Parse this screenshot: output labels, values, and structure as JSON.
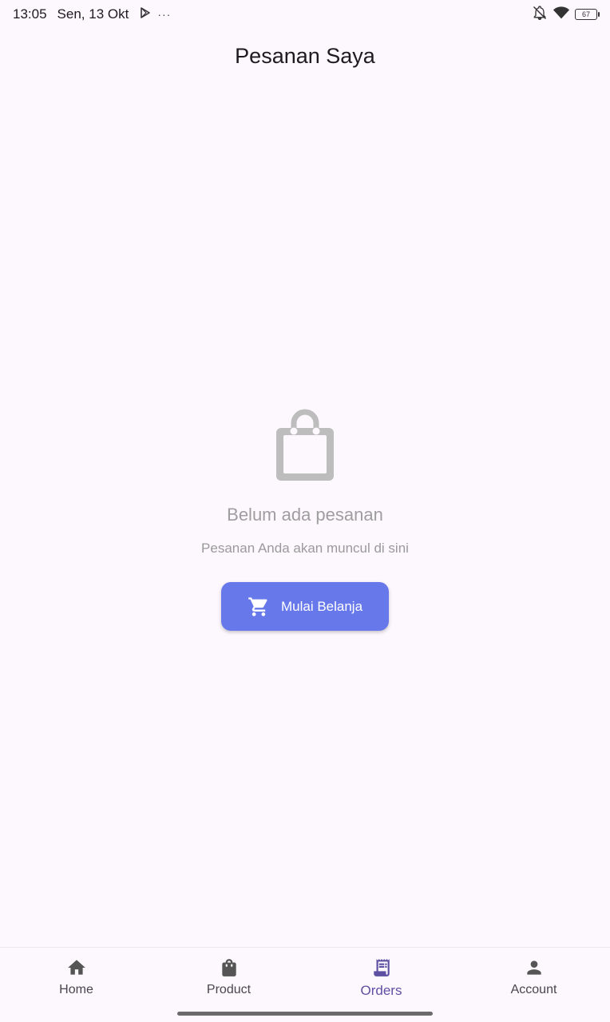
{
  "status_bar": {
    "time": "13:05",
    "date": "Sen, 13 Okt",
    "more": "···",
    "battery": "67"
  },
  "app_bar": {
    "title": "Pesanan Saya"
  },
  "empty_state": {
    "icon": "shopping-bag-icon",
    "title": "Belum ada pesanan",
    "subtitle": "Pesanan Anda akan muncul di sini",
    "button_label": "Mulai Belanja",
    "button_icon": "cart-icon"
  },
  "bottom_nav": {
    "items": [
      {
        "label": "Home",
        "icon": "home-icon",
        "active": false
      },
      {
        "label": "Product",
        "icon": "shopping-bag-icon",
        "active": false
      },
      {
        "label": "Orders",
        "icon": "receipt-icon",
        "active": true
      },
      {
        "label": "Account",
        "icon": "person-icon",
        "active": false
      }
    ]
  },
  "colors": {
    "background": "#FDF7FE",
    "primary_button": "#6779EA",
    "active_nav": "#5D50A2",
    "muted_text": "#9E9E9E"
  }
}
